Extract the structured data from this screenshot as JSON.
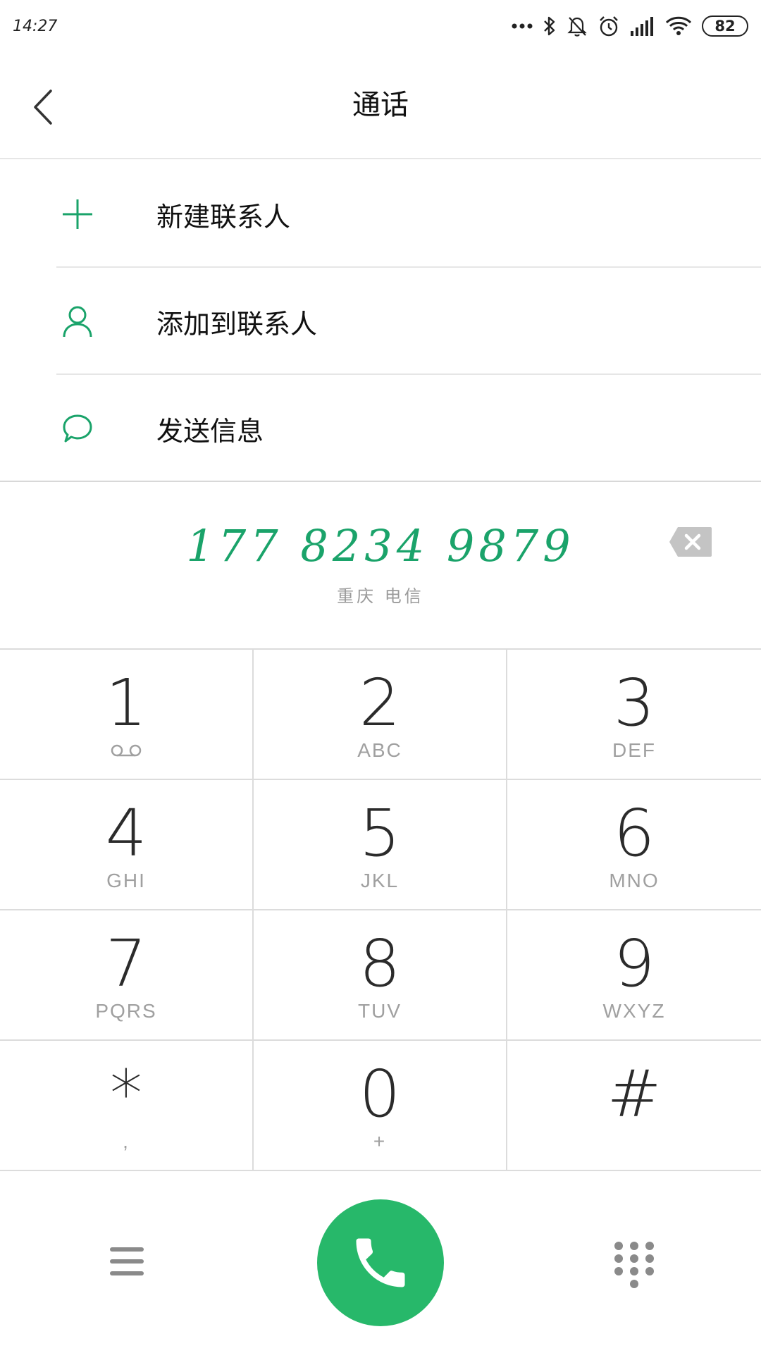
{
  "status_bar": {
    "time": "14:27",
    "battery": "82"
  },
  "header": {
    "title": "通话"
  },
  "actions": [
    {
      "label": "新建联系人",
      "icon": "plus-icon"
    },
    {
      "label": "添加到联系人",
      "icon": "person-icon"
    },
    {
      "label": "发送信息",
      "icon": "message-icon"
    }
  ],
  "dialer": {
    "number": "177 8234 9879",
    "carrier": "重庆 电信"
  },
  "keypad": [
    {
      "digit": "1",
      "letters": ""
    },
    {
      "digit": "2",
      "letters": "ABC"
    },
    {
      "digit": "3",
      "letters": "DEF"
    },
    {
      "digit": "4",
      "letters": "GHI"
    },
    {
      "digit": "5",
      "letters": "JKL"
    },
    {
      "digit": "6",
      "letters": "MNO"
    },
    {
      "digit": "7",
      "letters": "PQRS"
    },
    {
      "digit": "8",
      "letters": "TUV"
    },
    {
      "digit": "9",
      "letters": "WXYZ"
    },
    {
      "digit": "*",
      "letters": ","
    },
    {
      "digit": "0",
      "letters": "+"
    },
    {
      "digit": "#",
      "letters": ""
    }
  ],
  "colors": {
    "accent": "#1aa36a",
    "call_button": "#27b86a",
    "divider": "#e6e6e6"
  }
}
